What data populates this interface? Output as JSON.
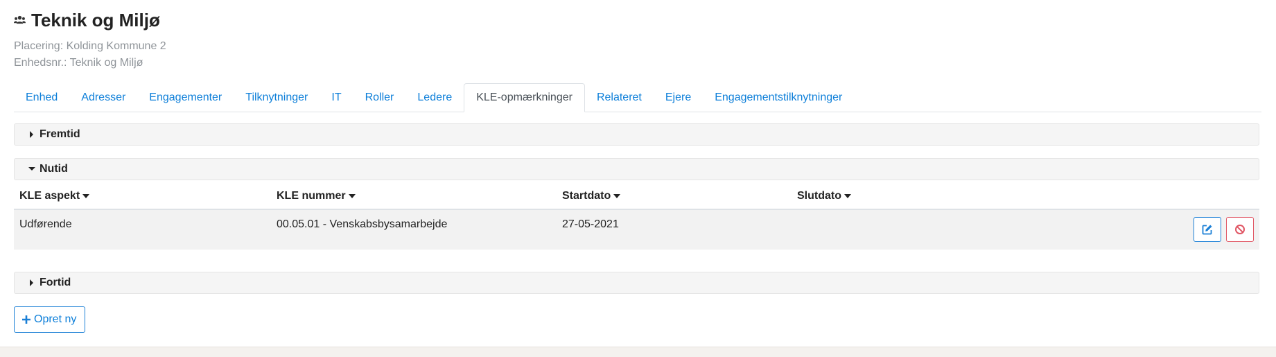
{
  "header": {
    "title": "Teknik og Miljø",
    "title_icon": "users-icon",
    "placement": "Placering: Kolding Kommune 2",
    "unit_no": "Enhedsnr.: Teknik og Miljø"
  },
  "tabs": [
    {
      "label": "Enhed",
      "active": false
    },
    {
      "label": "Adresser",
      "active": false
    },
    {
      "label": "Engagementer",
      "active": false
    },
    {
      "label": "Tilknytninger",
      "active": false
    },
    {
      "label": "IT",
      "active": false
    },
    {
      "label": "Roller",
      "active": false
    },
    {
      "label": "Ledere",
      "active": false
    },
    {
      "label": "KLE-opmærkninger",
      "active": true
    },
    {
      "label": "Relateret",
      "active": false
    },
    {
      "label": "Ejere",
      "active": false
    },
    {
      "label": "Engagementstilknytninger",
      "active": false
    }
  ],
  "sections": {
    "future": {
      "label": "Fremtid",
      "expanded": false
    },
    "present": {
      "label": "Nutid",
      "expanded": true
    },
    "past": {
      "label": "Fortid",
      "expanded": false
    }
  },
  "table": {
    "headers": [
      "KLE aspekt",
      "KLE nummer",
      "Startdato",
      "Slutdato"
    ],
    "rows": [
      {
        "aspect": "Udførende",
        "number": "00.05.01 - Venskabsbysamarbejde",
        "start": "27-05-2021",
        "end": ""
      }
    ]
  },
  "actions": {
    "edit_icon": "edit-icon",
    "delete_icon": "ban-icon",
    "create_label": "Opret ny"
  },
  "colors": {
    "link": "#0d7fd9",
    "primary_border": "#1a7fd6",
    "danger": "#e05563",
    "section_bg": "#f5f5f5",
    "row_bg": "#f2f2f2"
  }
}
